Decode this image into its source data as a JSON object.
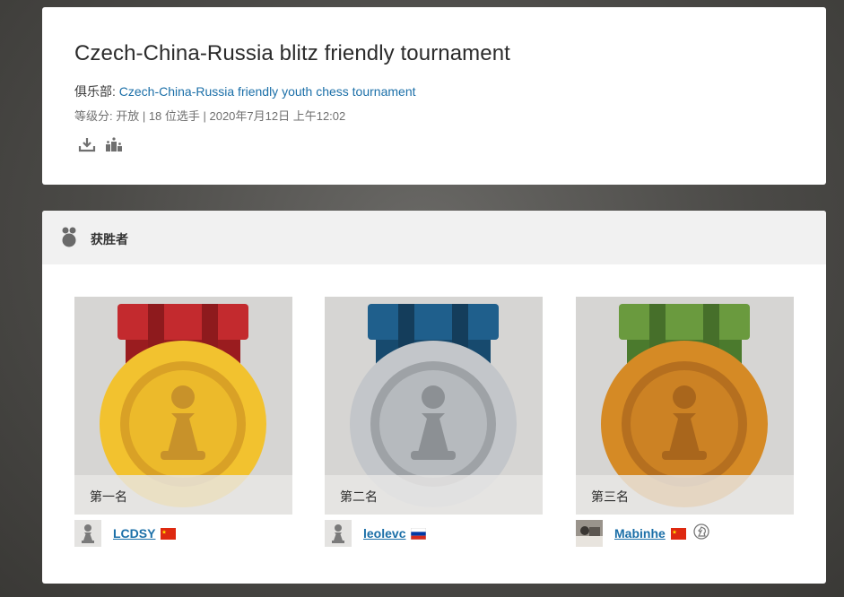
{
  "tournament": {
    "title": "Czech-China-Russia blitz friendly tournament",
    "club_label": "俱乐部: ",
    "club_name": "Czech-China-Russia friendly youth chess tournament",
    "meta": "等级分: 开放 | 18 位选手 | 2020年7月12日 上午12:02",
    "actions": [
      {
        "icon": "download-icon"
      },
      {
        "icon": "podium-chart-icon"
      }
    ]
  },
  "winners": {
    "heading": "获胜者",
    "heading_icon": "medal-icon",
    "entries": [
      {
        "place": "第一名",
        "medal": "gold",
        "ribbon_color": "#c0282c",
        "player": "LCDSY",
        "country": "China",
        "flag_icon": "china-flag-icon",
        "avatar": "pawn-avatar"
      },
      {
        "place": "第二名",
        "medal": "silver",
        "ribbon_color": "#1f5f8c",
        "player": "leolevc",
        "country": "Russia",
        "flag_icon": "russia-flag-icon",
        "avatar": "pawn-avatar"
      },
      {
        "place": "第三名",
        "medal": "bronze",
        "ribbon_color": "#5f8f3a",
        "player": "Mabinhe",
        "country": "China",
        "flag_icon": "china-flag-icon",
        "avatar": "photo-avatar",
        "extra_icon": "knight-icon"
      }
    ]
  },
  "colors": {
    "link": "#1b6fa8",
    "gold": "#f2c22f",
    "silver": "#bfc3c8",
    "bronze": "#d58a25"
  }
}
